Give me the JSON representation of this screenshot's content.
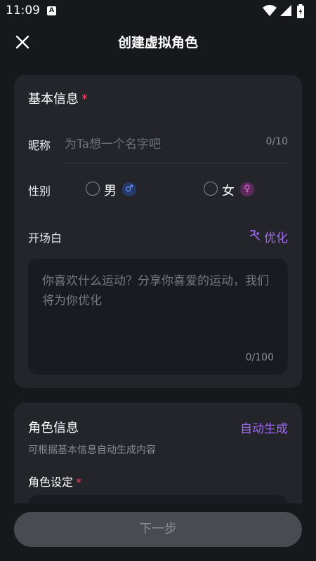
{
  "status_bar": {
    "time": "11:09",
    "notification_badge": "A",
    "icons": [
      "wifi-icon",
      "cellular-signal-icon",
      "battery-charging-icon"
    ]
  },
  "header": {
    "title": "创建虚拟角色",
    "close_icon": "close-icon"
  },
  "basic_info": {
    "title": "基本信息",
    "required_mark": "*",
    "nickname": {
      "label": "昵称",
      "placeholder": "为Ta想一个名字吧",
      "value": "",
      "count": "0/10"
    },
    "gender": {
      "label": "性别",
      "options": [
        {
          "label": "男",
          "symbol": "♂",
          "selected": false
        },
        {
          "label": "女",
          "symbol": "♀",
          "selected": false
        }
      ]
    },
    "opening": {
      "label": "开场白",
      "optimize_label": "优化",
      "placeholder": "你喜欢什么运动？分享你喜爱的运动，我们将为你优化",
      "count": "0/100"
    }
  },
  "role_info": {
    "title": "角色信息",
    "auto_generate_label": "自动生成",
    "subtitle": "可根据基本信息自动生成内容",
    "setting_label": "角色设定",
    "required_mark": "*"
  },
  "footer": {
    "next_label": "下一步"
  },
  "colors": {
    "background": "#17181c",
    "card": "#23252b",
    "accent": "#a068ef",
    "required": "#f0435f",
    "button_disabled": "#4a4b51"
  }
}
